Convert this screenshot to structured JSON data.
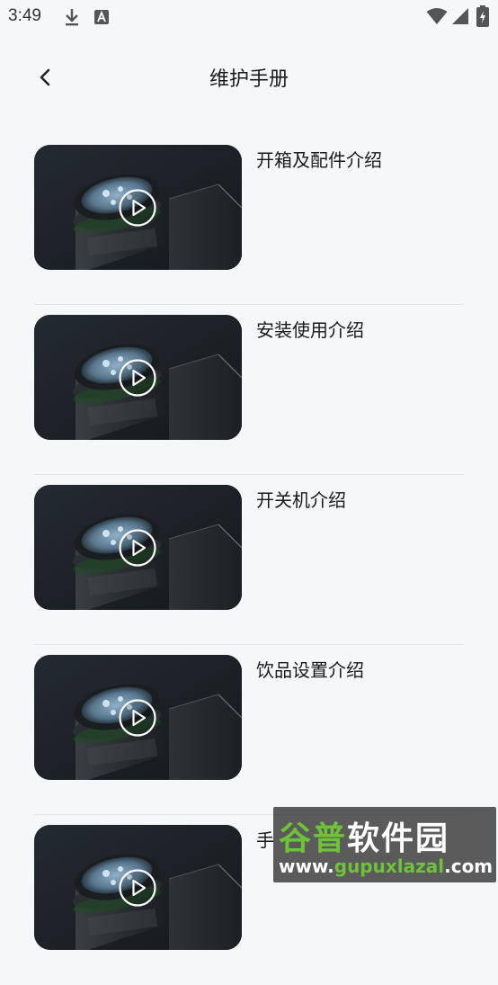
{
  "status_bar": {
    "time": "3:49"
  },
  "header": {
    "title": "维护手册"
  },
  "items": [
    {
      "title": "开箱及配件介绍"
    },
    {
      "title": "安装使用介绍"
    },
    {
      "title": "开关机介绍"
    },
    {
      "title": "饮品设置介绍"
    },
    {
      "title": "手"
    }
  ],
  "watermark": {
    "brand_part1": "谷普",
    "brand_part2": "软件园",
    "url_part1": "www.",
    "url_part2": "gupuxlazal",
    "url_part3": ".com"
  },
  "colors": {
    "background": "#f6f7f9",
    "divider": "#e3e4e7",
    "watermark_green": "#6fc33a"
  }
}
